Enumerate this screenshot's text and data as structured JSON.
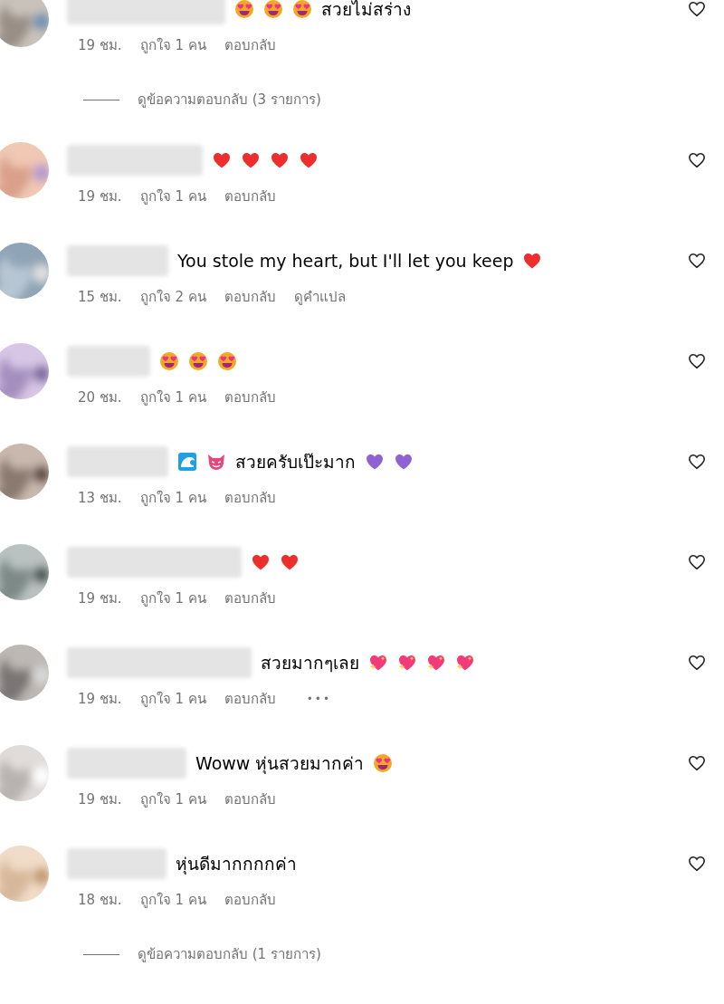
{
  "comments": [
    {
      "parts": [
        {
          "kind": "smiley"
        },
        {
          "kind": "smiley"
        },
        {
          "kind": "smiley"
        },
        {
          "kind": "text",
          "text": "สวยไม่สร่าง"
        }
      ],
      "meta": [
        {
          "kind": "time",
          "text": "19 ชม."
        },
        {
          "kind": "likes",
          "text": "ถูกใจ 1 คน"
        },
        {
          "kind": "reply",
          "text": "ตอบกลับ"
        }
      ],
      "replies_link": "ดูข้อความตอบกลับ (3 รายการ)"
    },
    {
      "parts": [
        {
          "kind": "heart",
          "color": "#f02d2d"
        },
        {
          "kind": "heart",
          "color": "#f02d2d"
        },
        {
          "kind": "heart",
          "color": "#f02d2d"
        },
        {
          "kind": "heart",
          "color": "#f02d2d"
        }
      ],
      "meta": [
        {
          "kind": "time",
          "text": "19 ชม."
        },
        {
          "kind": "likes",
          "text": "ถูกใจ 1 คน"
        },
        {
          "kind": "reply",
          "text": "ตอบกลับ"
        }
      ]
    },
    {
      "parts": [
        {
          "kind": "text",
          "text": "You stole my heart, but I'll let you keep"
        },
        {
          "kind": "heart",
          "color": "#f02d2d"
        }
      ],
      "meta": [
        {
          "kind": "time",
          "text": "15 ชม."
        },
        {
          "kind": "likes",
          "text": "ถูกใจ 2 คน"
        },
        {
          "kind": "reply",
          "text": "ตอบกลับ"
        },
        {
          "kind": "translate",
          "text": "ดูคำแปล"
        }
      ]
    },
    {
      "parts": [
        {
          "kind": "smiley"
        },
        {
          "kind": "smiley"
        },
        {
          "kind": "smiley"
        }
      ],
      "meta": [
        {
          "kind": "time",
          "text": "20 ชม."
        },
        {
          "kind": "likes",
          "text": "ถูกใจ 1 คน"
        },
        {
          "kind": "reply",
          "text": "ตอบกลับ"
        }
      ]
    },
    {
      "parts": [
        {
          "kind": "wave"
        },
        {
          "kind": "cat"
        },
        {
          "kind": "text",
          "text": "สวยครับเป๊ะมาก"
        },
        {
          "kind": "heart",
          "color": "#8e63cf"
        },
        {
          "kind": "heart",
          "color": "#8e63cf"
        }
      ],
      "meta": [
        {
          "kind": "time",
          "text": "13 ชม."
        },
        {
          "kind": "likes",
          "text": "ถูกใจ 1 คน"
        },
        {
          "kind": "reply",
          "text": "ตอบกลับ"
        }
      ]
    },
    {
      "parts": [
        {
          "kind": "heart",
          "color": "#f02d2d"
        },
        {
          "kind": "heart",
          "color": "#f02d2d"
        }
      ],
      "meta": [
        {
          "kind": "time",
          "text": "19 ชม."
        },
        {
          "kind": "likes",
          "text": "ถูกใจ 1 คน"
        },
        {
          "kind": "reply",
          "text": "ตอบกลับ"
        }
      ]
    },
    {
      "parts": [
        {
          "kind": "text",
          "text": "สวยมากๆเลย"
        },
        {
          "kind": "sparkle"
        },
        {
          "kind": "sparkle"
        },
        {
          "kind": "sparkle"
        },
        {
          "kind": "sparkle"
        }
      ],
      "meta": [
        {
          "kind": "time",
          "text": "19 ชม."
        },
        {
          "kind": "likes",
          "text": "ถูกใจ 1 คน"
        },
        {
          "kind": "reply",
          "text": "ตอบกลับ"
        },
        {
          "kind": "more",
          "text": "•••"
        }
      ]
    },
    {
      "parts": [
        {
          "kind": "text",
          "text": "Woww หุ่นสวยมากค่า"
        },
        {
          "kind": "smiley"
        }
      ],
      "meta": [
        {
          "kind": "time",
          "text": "19 ชม."
        },
        {
          "kind": "likes",
          "text": "ถูกใจ 1 คน"
        },
        {
          "kind": "reply",
          "text": "ตอบกลับ"
        }
      ]
    },
    {
      "parts": [
        {
          "kind": "text",
          "text": "หุ่นดีมากกกกค่า"
        }
      ],
      "meta": [
        {
          "kind": "time",
          "text": "18 ชม."
        },
        {
          "kind": "likes",
          "text": "ถูกใจ 1 คน"
        },
        {
          "kind": "reply",
          "text": "ตอบกลับ"
        }
      ],
      "replies_link": "ดูข้อความตอบกลับ (1 รายการ)"
    }
  ]
}
